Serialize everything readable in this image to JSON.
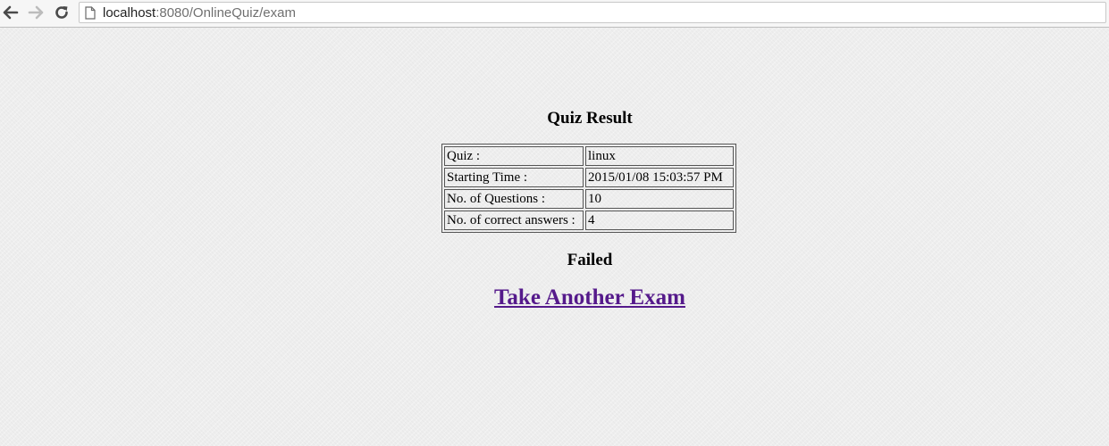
{
  "browser": {
    "url_host": "localhost",
    "url_rest": ":8080/OnlineQuiz/exam"
  },
  "result": {
    "title": "Quiz Result",
    "rows": [
      {
        "label": "Quiz :",
        "value": "linux"
      },
      {
        "label": "Starting Time :",
        "value": "2015/01/08 15:03:57 PM"
      },
      {
        "label": "No. of Questions :",
        "value": "10"
      },
      {
        "label": "No. of correct answers :",
        "value": "4"
      }
    ],
    "status": "Failed",
    "link_label": "Take Another Exam"
  },
  "colors": {
    "link": "#551a8b",
    "background": "#eeeeee"
  }
}
